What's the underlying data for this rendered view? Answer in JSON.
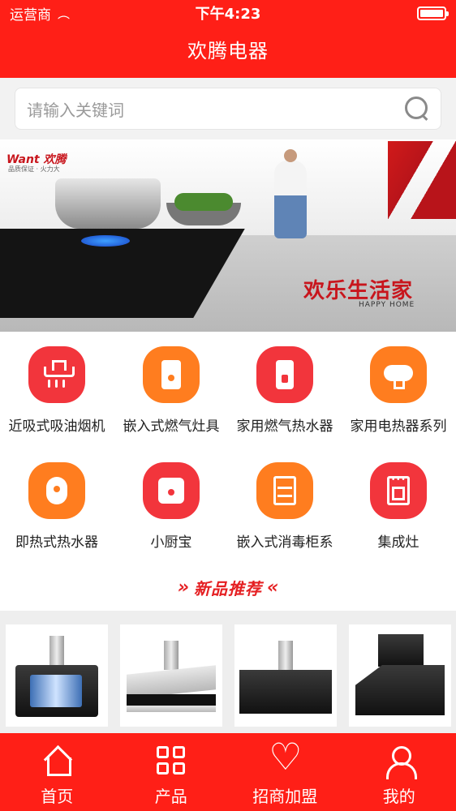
{
  "status_bar": {
    "carrier": "运营商",
    "time": "下午4:23"
  },
  "header": {
    "title": "欢腾电器"
  },
  "search": {
    "placeholder": "请输入关键词"
  },
  "banner": {
    "brand": "Want 欢腾",
    "brand_sub": "品质保证 · 火力大",
    "tagline": "欢乐生活家",
    "tagline_en": "HAPPY HOME"
  },
  "categories": [
    {
      "label": "近吸式吸油烟机",
      "icon": "range-hood-icon",
      "color": "#f2353c"
    },
    {
      "label": "嵌入式燃气灶具",
      "icon": "gas-stove-icon",
      "color": "#ff7d1f"
    },
    {
      "label": "家用燃气热水器",
      "icon": "gas-water-heater-icon",
      "color": "#f2353c"
    },
    {
      "label": "家用电热器系列",
      "icon": "electric-water-heater-icon",
      "color": "#ff7d1f"
    },
    {
      "label": "即热式热水器",
      "icon": "instant-water-heater-icon",
      "color": "#ff7d1f"
    },
    {
      "label": "小厨宝",
      "icon": "kitchen-heater-icon",
      "color": "#f2353c"
    },
    {
      "label": "嵌入式消毒柜系",
      "icon": "disinfection-cabinet-icon",
      "color": "#ff7d1f"
    },
    {
      "label": "集成灶",
      "icon": "integrated-stove-icon",
      "color": "#f2353c"
    }
  ],
  "new_products": {
    "heading": "新品推荐",
    "chev_left": "»",
    "chev_right": "«"
  },
  "tabs": [
    {
      "label": "首页",
      "icon": "home-icon"
    },
    {
      "label": "产品",
      "icon": "grid-icon"
    },
    {
      "label": "招商加盟",
      "icon": "handshake-heart-icon"
    },
    {
      "label": "我的",
      "icon": "user-icon"
    }
  ]
}
